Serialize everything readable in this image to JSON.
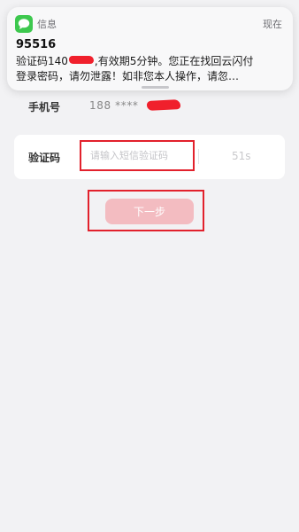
{
  "notification": {
    "app_name": "信息",
    "time": "现在",
    "sender": "95516",
    "line1_prefix": "验证码140",
    "line1_suffix": ",有效期5分钟。您正在找回云闪付",
    "line2": "登录密码，请勿泄露！如非您本人操作，请忽…",
    "app_icon": "messages-icon"
  },
  "phone": {
    "label": "手机号",
    "value": "188 ****"
  },
  "code": {
    "label": "验证码",
    "placeholder": "请输入短信验证码",
    "countdown": "51s"
  },
  "next_button": {
    "label": "下一步"
  },
  "colors": {
    "annotation_red": "#e2212c",
    "button_disabled": "#f3bcc1",
    "messages_green": "#3dc84e"
  }
}
